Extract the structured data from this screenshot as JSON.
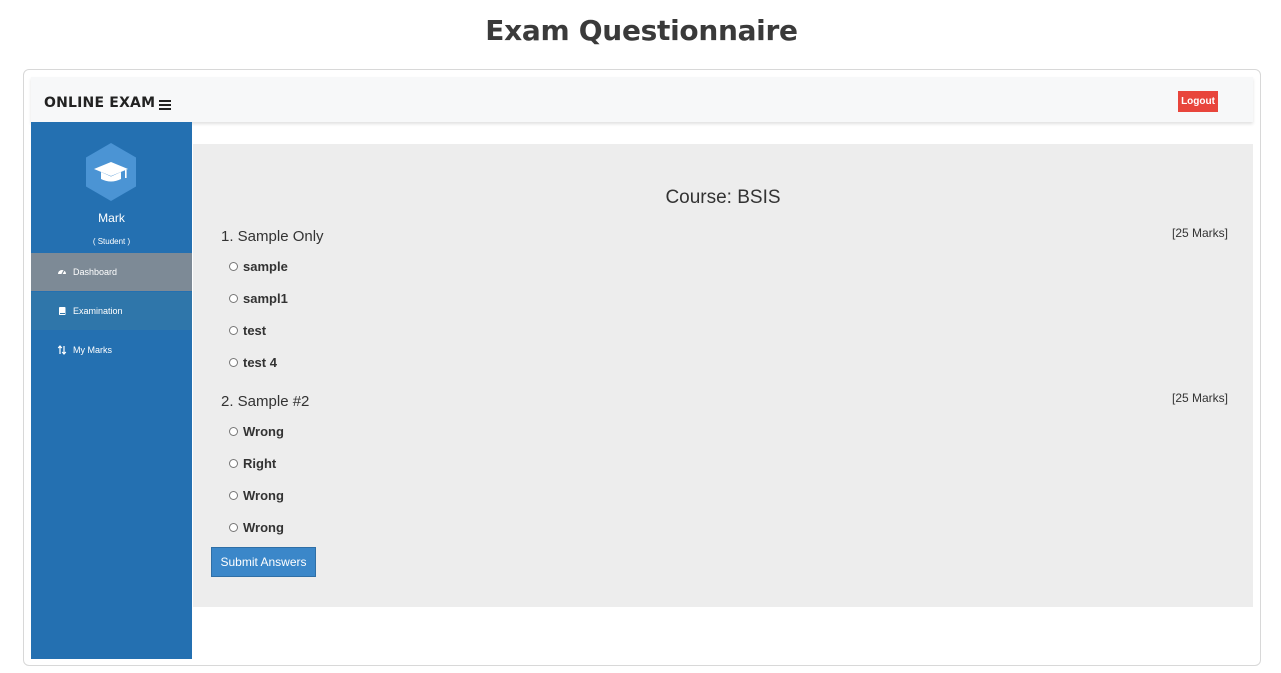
{
  "page": {
    "title": "Exam Questionnaire"
  },
  "topbar": {
    "brand": "ONLINE EXAM",
    "logout_label": "Logout"
  },
  "sidebar": {
    "user_name": "Mark",
    "user_role": "( Student )",
    "items": [
      {
        "label": "Dashboard",
        "icon": "dashboard-icon",
        "active": true
      },
      {
        "label": "Examination",
        "icon": "book-icon"
      },
      {
        "label": "My Marks",
        "icon": "sort-icon"
      }
    ]
  },
  "exam": {
    "course": "Course: BSIS",
    "questions": [
      {
        "text": "1. Sample Only",
        "marks": "[25 Marks]",
        "options": [
          "sample",
          "sampl1",
          "test",
          "test 4"
        ]
      },
      {
        "text": "2. Sample #2",
        "marks": "[25 Marks]",
        "options": [
          "Wrong",
          "Right",
          "Wrong",
          "Wrong"
        ]
      }
    ],
    "submit_label": "Submit Answers"
  },
  "colors": {
    "sidebar": "#2470b1",
    "active_nav": "#7d8a96",
    "logout": "#e8453c",
    "submit": "#3b87c9",
    "content_bg": "#ededed"
  }
}
